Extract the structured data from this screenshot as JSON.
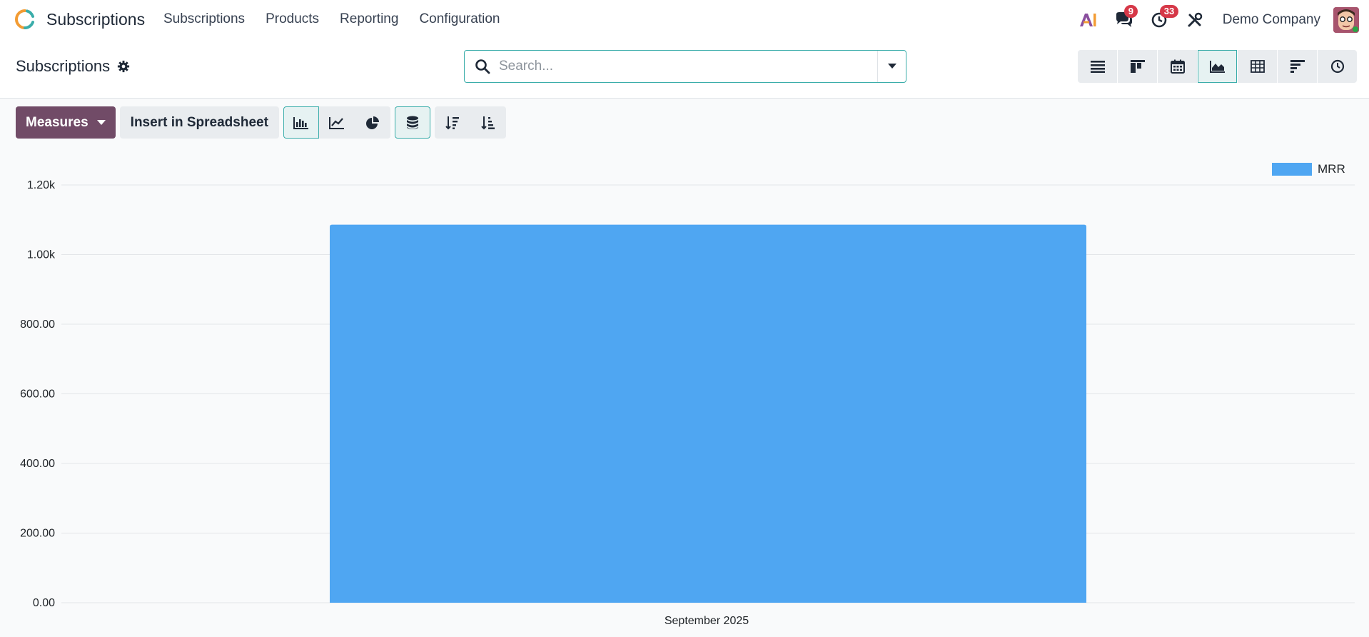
{
  "navbar": {
    "app_name": "Subscriptions",
    "menu": [
      "Subscriptions",
      "Products",
      "Reporting",
      "Configuration"
    ],
    "messages_count": "9",
    "activities_count": "33",
    "company": "Demo Company"
  },
  "control_panel": {
    "title": "Subscriptions",
    "search_placeholder": "Search..."
  },
  "toolbar": {
    "measures_label": "Measures",
    "insert_label": "Insert in Spreadsheet"
  },
  "colors": {
    "brand": "#714b67",
    "accent": "#3aadaa",
    "bar": "#4fa6f2",
    "badge": "#d63848"
  },
  "chart_data": {
    "type": "bar",
    "categories": [
      "September 2025"
    ],
    "series": [
      {
        "name": "MRR",
        "values": [
          1086
        ]
      }
    ],
    "ylim": [
      0,
      1200
    ],
    "yticks": [
      0,
      200,
      400,
      600,
      800,
      1000,
      1200
    ],
    "ytick_labels": [
      "0.00",
      "200.00",
      "400.00",
      "600.00",
      "800.00",
      "1.00k",
      "1.20k"
    ],
    "grid": true,
    "legend_position": "top-right"
  }
}
